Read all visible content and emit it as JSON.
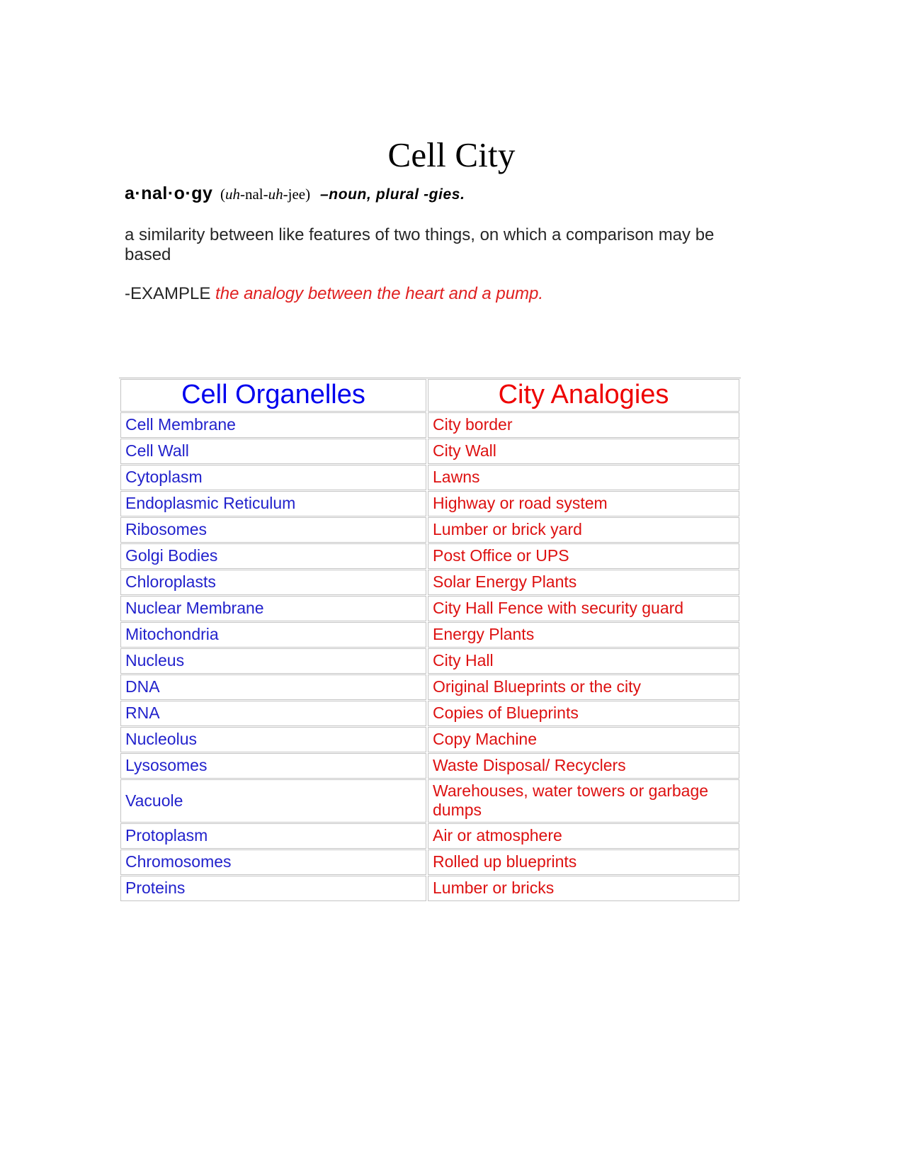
{
  "document": {
    "title": "Cell City"
  },
  "definition": {
    "headword": "a·nal·o·gy",
    "pron_open": "(",
    "pron_uh1": "uh",
    "pron_sep1": "-",
    "pron_nal": "nal",
    "pron_sep2": "-",
    "pron_uh2": "uh",
    "pron_sep3": "-",
    "pron_jee": "jee)",
    "part_of_speech": "–noun, plural -gies.",
    "meaning": "a similarity between like features of two things, on which a comparison may be based",
    "example_label": "-EXAMPLE ",
    "example_text": "the analogy between the heart and a pump."
  },
  "colors": {
    "organelle_header": "#0000ee",
    "analogy_header": "#ee0000",
    "organelle_text": "#2222cc",
    "analogy_text": "#dd1111",
    "table_border": "#c4c4c4",
    "body_text": "#262626"
  },
  "table": {
    "headers": {
      "col1": "Cell Organelles",
      "col2": "City Analogies"
    },
    "rows": [
      {
        "organelle": "Cell Membrane",
        "analogy": "City border"
      },
      {
        "organelle": "Cell Wall",
        "analogy": "City Wall"
      },
      {
        "organelle": "Cytoplasm",
        "analogy": "Lawns"
      },
      {
        "organelle": "Endoplasmic Reticulum",
        "analogy": "Highway  or road system"
      },
      {
        "organelle": "Ribosomes",
        "analogy": "Lumber or brick yard"
      },
      {
        "organelle": "Golgi Bodies",
        "analogy": "Post Office or UPS"
      },
      {
        "organelle": "Chloroplasts",
        "analogy": "Solar Energy Plants"
      },
      {
        "organelle": "Nuclear Membrane",
        "analogy": "City Hall Fence with security guard"
      },
      {
        "organelle": "Mitochondria",
        "analogy": "Energy Plants"
      },
      {
        "organelle": "Nucleus",
        "analogy": "City Hall"
      },
      {
        "organelle": "DNA",
        "analogy": "Original Blueprints or the city"
      },
      {
        "organelle": "RNA",
        "analogy": "Copies of Blueprints"
      },
      {
        "organelle": "Nucleolus",
        "analogy": "Copy Machine"
      },
      {
        "organelle": "Lysosomes",
        "analogy": "Waste Disposal/ Recyclers"
      },
      {
        "organelle": "Vacuole",
        "analogy": "Warehouses, water towers or garbage dumps",
        "tall": true
      },
      {
        "organelle": "Protoplasm",
        "analogy": "Air or atmosphere"
      },
      {
        "organelle": "Chromosomes",
        "analogy": "Rolled up blueprints"
      },
      {
        "organelle": "Proteins",
        "analogy": "Lumber or bricks"
      }
    ]
  }
}
